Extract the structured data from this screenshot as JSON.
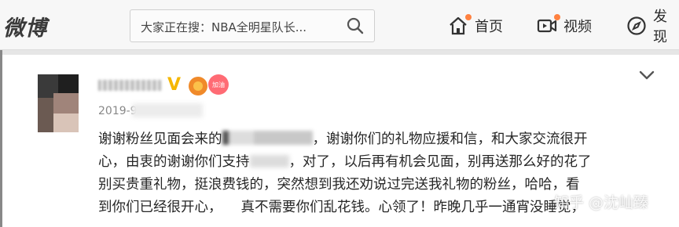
{
  "header": {
    "logo": "微博",
    "search": {
      "text": "大家正在搜：NBA全明星队长..."
    },
    "nav": [
      {
        "label": "首页",
        "icon": "home-icon",
        "has_dot": true
      },
      {
        "label": "视频",
        "icon": "video-icon",
        "has_dot": true
      },
      {
        "label": "发现",
        "icon": "compass-icon",
        "has_dot": false
      }
    ]
  },
  "post": {
    "date": "2019-9",
    "badge_text": "加油",
    "lines": [
      [
        "谢谢粉丝见面会来的",
        "，谢谢你们的礼物应援和信，和大家交流很开"
      ],
      [
        "心，由衷的谢谢你们支持",
        "，对了，以后再有机会见面，别再送那么好的花了"
      ],
      [
        "别买贵重礼物，挺浪费钱的，突然想到我还劝说过完送我礼物的粉丝，哈哈，看"
      ],
      [
        "到你们已经很开心，",
        "真不需要你们乱花钱。心领了！昨晚几乎一通宵没睡觉，"
      ]
    ]
  },
  "watermark": "知乎 @沈屾臻",
  "colors": {
    "accent_dot": "#ff8140",
    "vip": "#f5b700",
    "text": "#262626"
  }
}
